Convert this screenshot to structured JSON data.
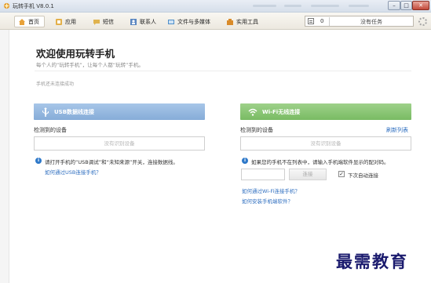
{
  "window": {
    "title": "玩转手机 V8.0.1",
    "controls": {
      "minimize": "–",
      "maximize": "□",
      "close": "✕"
    }
  },
  "toolbar": {
    "tabs": [
      {
        "label": "首页",
        "icon": "home-icon"
      },
      {
        "label": "应用",
        "icon": "apps-icon"
      },
      {
        "label": "短信",
        "icon": "sms-icon"
      },
      {
        "label": "联系人",
        "icon": "contacts-icon"
      },
      {
        "label": "文件与多媒体",
        "icon": "files-icon"
      },
      {
        "label": "实用工具",
        "icon": "tools-icon"
      }
    ],
    "task_count": "0",
    "task_status": "没有任务"
  },
  "welcome": {
    "title": "欢迎使用玩转手机",
    "subtitle": "每个人的“玩转手机”，让每个人都“玩转”手机。",
    "connection_status": "手机还未连接成功"
  },
  "usb": {
    "header": "USB数据线连接",
    "detected_label": "检测到的设备",
    "device_placeholder": "没有识别设备",
    "info": "请打开手机的“USB调试”和“未知来源”开关，连接数据线。",
    "howto_link": "如何通过USB连接手机？"
  },
  "wifi": {
    "header": "Wi-Fi无线连接",
    "detected_label": "检测到的设备",
    "refresh_link": "刷新列表",
    "device_placeholder": "没有识别设备",
    "info": "如果您的手机不在列表中，请输入手机端软件显示的配对码。",
    "connect_button": "连接",
    "auto_connect_label": "下次自动连接",
    "auto_connect_checked": "✓",
    "howto_link": "如何通过Wi-Fi连接手机？",
    "install_link": "如何安装手机端软件？"
  },
  "watermark": "最需教育",
  "colors": {
    "usb_header": "#86acd8",
    "wifi_header": "#79bb63",
    "link": "#2f6fc0"
  }
}
